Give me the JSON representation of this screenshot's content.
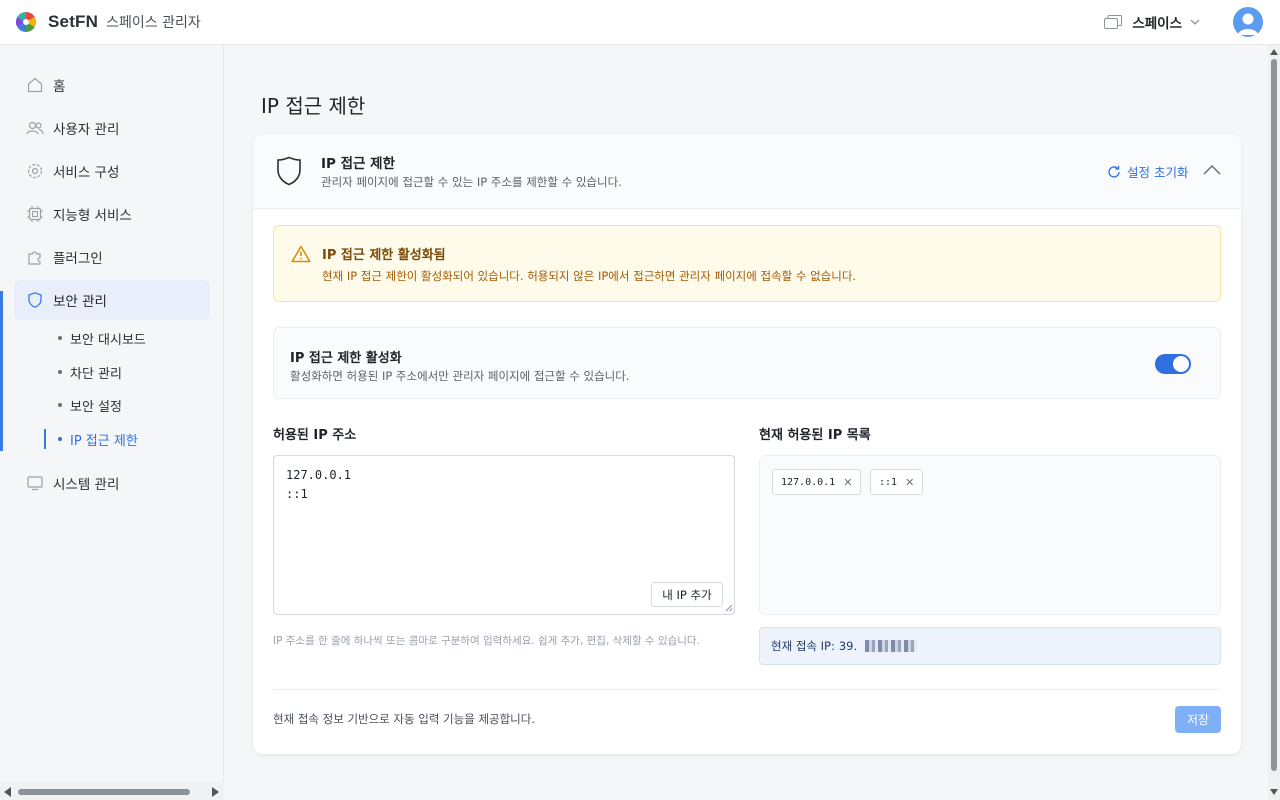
{
  "header": {
    "brand": "SetFN",
    "app_title": "스페이스 관리자",
    "space_label": "스페이스"
  },
  "sidebar": {
    "items": [
      {
        "label": "홈",
        "icon": "home-icon"
      },
      {
        "label": "사용자 관리",
        "icon": "users-icon"
      },
      {
        "label": "서비스 구성",
        "icon": "gear-icon"
      },
      {
        "label": "지능형 서비스",
        "icon": "chip-icon"
      },
      {
        "label": "플러그인",
        "icon": "puzzle-icon"
      },
      {
        "label": "보안 관리",
        "icon": "shield-icon",
        "active": true
      },
      {
        "label": "시스템 관리",
        "icon": "monitor-icon"
      }
    ],
    "security_sub": [
      "보안 대시보드",
      "차단 관리",
      "보안 설정",
      "IP 접근 제한"
    ],
    "current_sub": "IP 접근 제한"
  },
  "page": {
    "title": "IP 접근 제한"
  },
  "card": {
    "title": "IP 접근 제한",
    "description": "관리자 페이지에 접근할 수 있는 IP 주소를 제한할 수 있습니다.",
    "reset_label": "설정 초기화"
  },
  "alert": {
    "title": "IP 접근 제한 활성화됨",
    "text": "현재 IP 접근 제한이 활성화되어 있습니다. 허용되지 않은 IP에서 접근하면 관리자 페이지에 접속할 수 없습니다."
  },
  "toggle": {
    "title": "IP 접근 제한 활성화",
    "description": "활성화하면 허용된 IP 주소에서만 관리자 페이지에 접근할 수 있습니다.",
    "enabled": true
  },
  "allowed": {
    "title": "허용된 IP 주소",
    "value": "127.0.0.1\n::1",
    "my_ip_button": "내 IP 추가",
    "hint": "IP 주소를 한 줄에 하나씩 또는 콤마로 구분하여 입력하세요. 쉽게 추가, 편집, 삭제할 수 있습니다."
  },
  "current_list": {
    "title": "현재 허용된 IP 목록",
    "tags": [
      "127.0.0.1",
      "::1"
    ],
    "current_ip_label": "현재 접속 IP:",
    "current_ip_value": "39."
  },
  "footer": {
    "text": "현재 접속 정보 기반으로 자동 입력 기능을 제공합니다.",
    "save_label": "저장"
  },
  "colors": {
    "accent": "#2f6fe0",
    "save_button": "#7fb0f5",
    "alert_bg": "#fefbea",
    "alert_title": "#7a4a06",
    "alert_text": "#a45a06"
  }
}
